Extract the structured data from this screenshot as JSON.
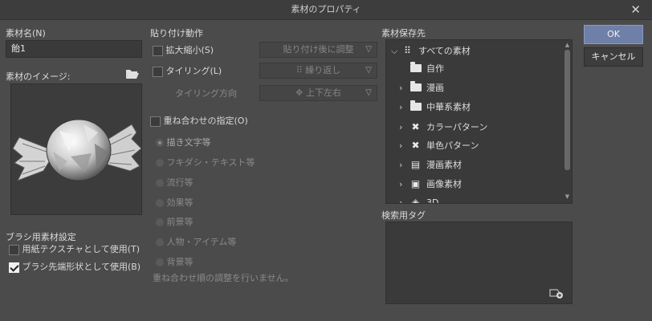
{
  "window": {
    "title": "素材のプロパティ",
    "close_glyph": "✕"
  },
  "name_section": {
    "label": "素材名(N)",
    "value": "飴1"
  },
  "image_section": {
    "label": "素材のイメージ:",
    "icon": "folder-open-icon"
  },
  "brush_section": {
    "label": "ブラシ用素材設定",
    "paper_texture": {
      "label": "用紙テクスチャとして使用(T)",
      "checked": false
    },
    "brush_tip": {
      "label": "ブラシ先端形状として使用(B)",
      "checked": true
    }
  },
  "paste_section": {
    "label": "貼り付け動作",
    "scale": {
      "label": "拡大縮小(S)",
      "checked": false,
      "dropdown": "貼り付け後に調整"
    },
    "tiling": {
      "label": "タイリング(L)",
      "checked": false,
      "dropdown": "繰り返し"
    },
    "tiling_direction": {
      "label": "タイリング方向",
      "dropdown": "上下左右"
    }
  },
  "overlay_section": {
    "label": "重ね合わせの指定(O)",
    "checked": false,
    "options": [
      "描き文字等",
      "フキダシ・テキスト等",
      "流行等",
      "効果等",
      "前景等",
      "人物・アイテム等",
      "背景等"
    ],
    "selected_index": 0,
    "note": "重ね合わせ順の調整を行いません。"
  },
  "storage_section": {
    "label": "素材保存先",
    "tree": [
      {
        "label": "すべての素材",
        "arrow": "⌵",
        "icon": "grid-icon",
        "depth": 0,
        "selected": false
      },
      {
        "label": "自作",
        "arrow": "",
        "icon": "folder-icon",
        "depth": 1,
        "selected": false
      },
      {
        "label": "漫画",
        "arrow": "›",
        "icon": "folder-icon",
        "depth": 1,
        "selected": false
      },
      {
        "label": "中華系素材",
        "arrow": "›",
        "icon": "folder-icon",
        "depth": 1,
        "selected": false
      },
      {
        "label": "カラーパターン",
        "arrow": "›",
        "icon": "color-pattern-icon",
        "depth": 1,
        "selected": false
      },
      {
        "label": "単色パターン",
        "arrow": "›",
        "icon": "mono-pattern-icon",
        "depth": 1,
        "selected": false
      },
      {
        "label": "漫画素材",
        "arrow": "›",
        "icon": "manga-material-icon",
        "depth": 1,
        "selected": false
      },
      {
        "label": "画像素材",
        "arrow": "›",
        "icon": "image-material-icon",
        "depth": 1,
        "selected": false
      },
      {
        "label": "3D",
        "arrow": "›",
        "icon": "cube-icon",
        "depth": 1,
        "selected": false
      }
    ]
  },
  "tag_section": {
    "label": "検索用タグ",
    "add_icon": "add-tag-icon"
  },
  "buttons": {
    "ok": "OK",
    "cancel": "キャンセル"
  }
}
